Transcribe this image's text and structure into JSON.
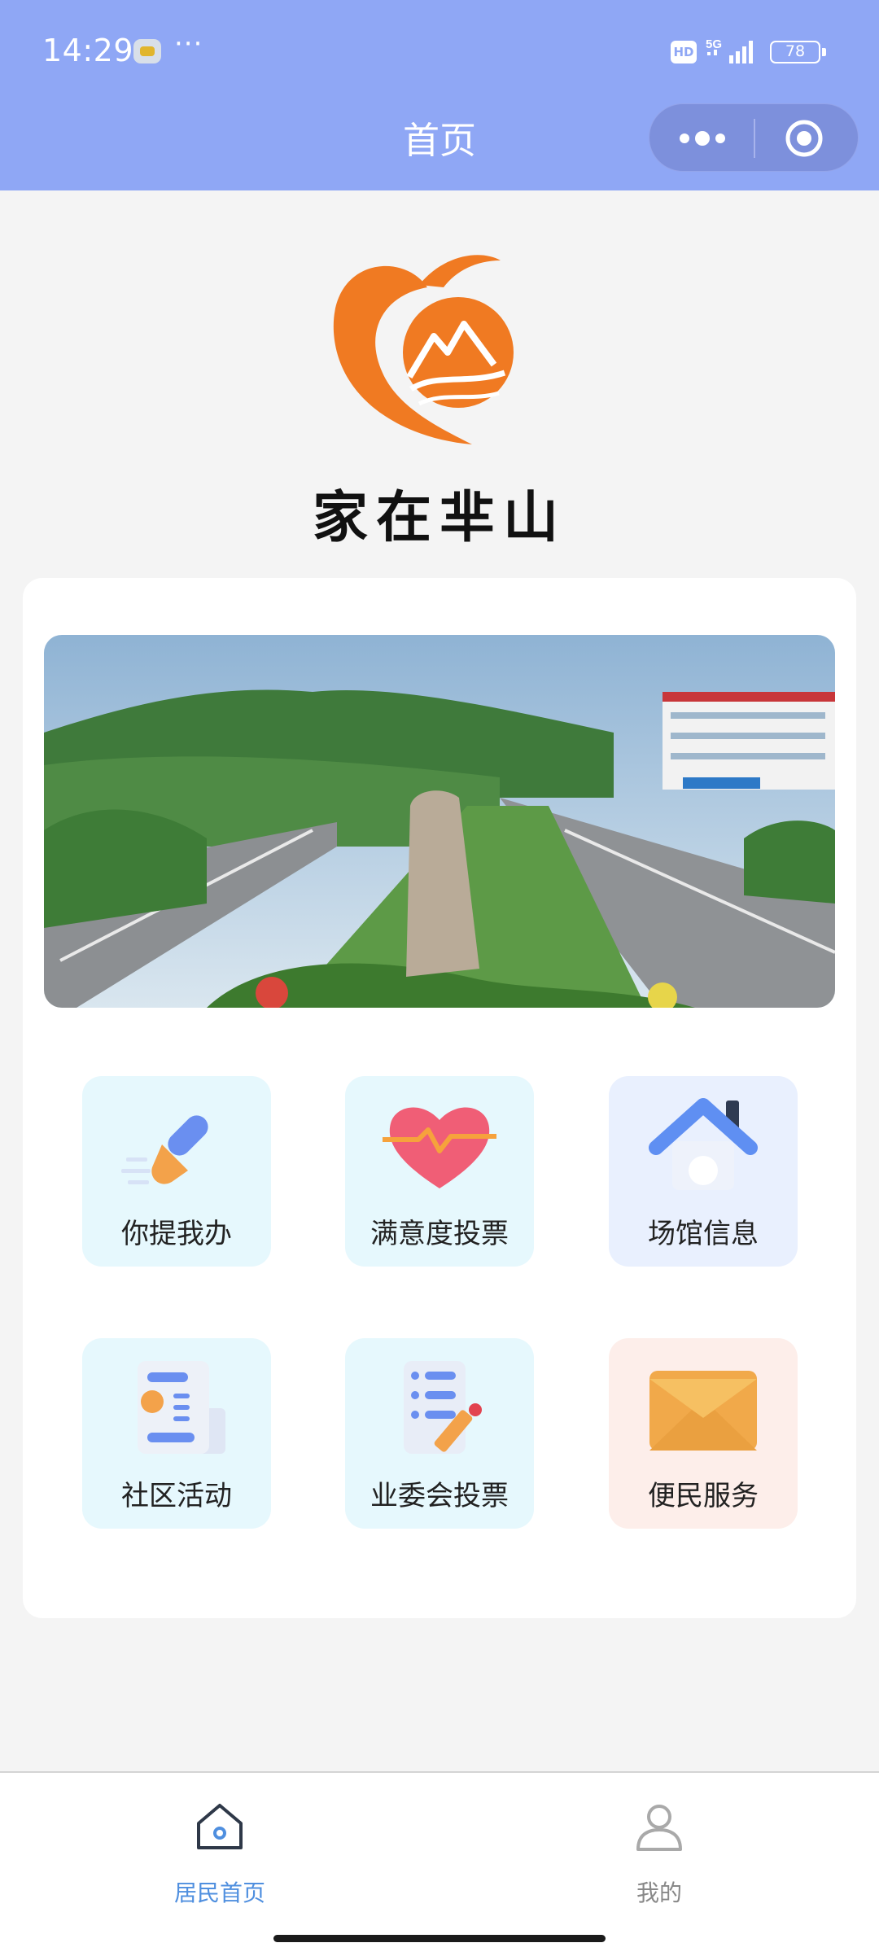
{
  "status_bar": {
    "time": "14:29",
    "more": "···",
    "network_badge": "HD",
    "network_type": "5G",
    "battery": "78"
  },
  "nav": {
    "title": "首页",
    "capsule_more_icon": "more-dots-icon",
    "capsule_close_icon": "target-close-icon"
  },
  "logo": {
    "text": "家在芈山",
    "mark_icon": "peach-heart-mountain-logo"
  },
  "banner": {
    "description_icon": "community-street-photo"
  },
  "grid": {
    "items": [
      {
        "label": "你提我办",
        "icon": "brush-icon",
        "bg": "#e6f8fd"
      },
      {
        "label": "满意度投票",
        "icon": "heart-pulse-icon",
        "bg": "#e6f8fd"
      },
      {
        "label": "场馆信息",
        "icon": "house-icon",
        "bg": "#e9f0fe"
      },
      {
        "label": "社区活动",
        "icon": "document-list-icon",
        "bg": "#e6f8fd"
      },
      {
        "label": "业委会投票",
        "icon": "checklist-pencil-icon",
        "bg": "#e6f8fd"
      },
      {
        "label": "便民服务",
        "icon": "envelope-icon",
        "bg": "#fdeeea"
      }
    ]
  },
  "tabbar": {
    "items": [
      {
        "label": "居民首页",
        "icon": "home-icon",
        "active": true
      },
      {
        "label": "我的",
        "icon": "user-icon",
        "active": false
      }
    ],
    "active_color": "#4f8fdf",
    "inactive_color": "#888888"
  },
  "colors": {
    "header_bg": "#8fa7f5",
    "logo_orange": "#f07a22"
  }
}
